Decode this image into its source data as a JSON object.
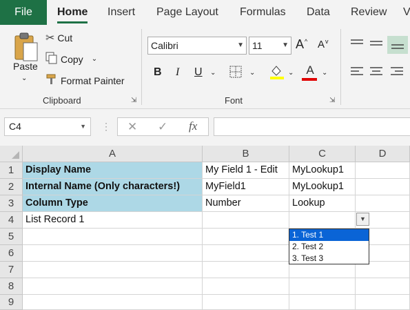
{
  "tabs": [
    {
      "label": "File"
    },
    {
      "label": "Home"
    },
    {
      "label": "Insert"
    },
    {
      "label": "Page Layout"
    },
    {
      "label": "Formulas"
    },
    {
      "label": "Data"
    },
    {
      "label": "Review"
    },
    {
      "label": "V"
    }
  ],
  "clipboard": {
    "paste_label": "Paste",
    "cut_label": "Cut",
    "copy_label": "Copy",
    "format_painter_label": "Format Painter",
    "group_label": "Clipboard"
  },
  "font": {
    "font_name": "Calibri",
    "font_size": "11",
    "group_label": "Font",
    "grow_label": "A",
    "shrink_label": "A",
    "bold_label": "B",
    "italic_label": "I",
    "underline_label": "U",
    "font_color_label": "A"
  },
  "colors": {
    "accent": "#1e7145",
    "header_fill": "#add8e6",
    "highlight": "#ffff00",
    "font_color": "#e00000",
    "selection": "#0a64d6"
  },
  "formula_bar": {
    "name_box": "C4",
    "fx_label": "fx",
    "formula": ""
  },
  "sheet": {
    "columns": [
      "A",
      "B",
      "C",
      "D"
    ],
    "rows": [
      {
        "num": "1",
        "cells": [
          "Display Name",
          "My Field 1 - Edit",
          "MyLookup1",
          ""
        ]
      },
      {
        "num": "2",
        "cells": [
          "Internal Name (Only characters!)",
          "MyField1",
          "MyLookup1",
          ""
        ]
      },
      {
        "num": "3",
        "cells": [
          "Column Type",
          "Number",
          "Lookup",
          ""
        ]
      },
      {
        "num": "4",
        "cells": [
          "List Record 1",
          "",
          "",
          ""
        ]
      },
      {
        "num": "5",
        "cells": [
          "",
          "",
          "",
          ""
        ]
      },
      {
        "num": "6",
        "cells": [
          "",
          "",
          "",
          ""
        ]
      },
      {
        "num": "7",
        "cells": [
          "",
          "",
          "",
          ""
        ]
      },
      {
        "num": "8",
        "cells": [
          "",
          "",
          "",
          ""
        ]
      },
      {
        "num": "9",
        "cells": [
          "",
          "",
          "",
          ""
        ]
      }
    ]
  },
  "dropdown": {
    "options": [
      "1. Test 1",
      "2. Test 2",
      "3. Test 3"
    ],
    "selected_index": 0
  }
}
